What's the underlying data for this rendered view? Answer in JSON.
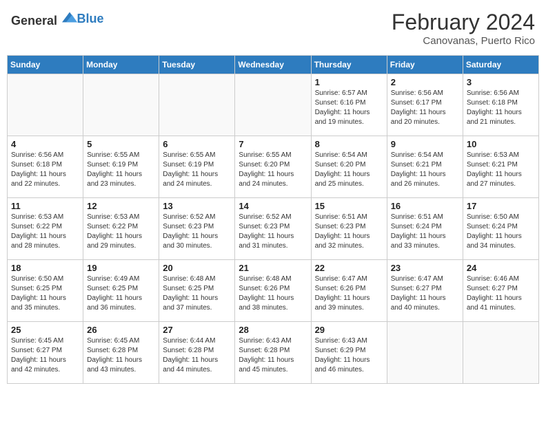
{
  "header": {
    "logo_general": "General",
    "logo_blue": "Blue",
    "title": "February 2024",
    "subtitle": "Canovanas, Puerto Rico"
  },
  "days_of_week": [
    "Sunday",
    "Monday",
    "Tuesday",
    "Wednesday",
    "Thursday",
    "Friday",
    "Saturday"
  ],
  "weeks": [
    [
      {
        "day": "",
        "detail": ""
      },
      {
        "day": "",
        "detail": ""
      },
      {
        "day": "",
        "detail": ""
      },
      {
        "day": "",
        "detail": ""
      },
      {
        "day": "1",
        "detail": "Sunrise: 6:57 AM\nSunset: 6:16 PM\nDaylight: 11 hours\nand 19 minutes."
      },
      {
        "day": "2",
        "detail": "Sunrise: 6:56 AM\nSunset: 6:17 PM\nDaylight: 11 hours\nand 20 minutes."
      },
      {
        "day": "3",
        "detail": "Sunrise: 6:56 AM\nSunset: 6:18 PM\nDaylight: 11 hours\nand 21 minutes."
      }
    ],
    [
      {
        "day": "4",
        "detail": "Sunrise: 6:56 AM\nSunset: 6:18 PM\nDaylight: 11 hours\nand 22 minutes."
      },
      {
        "day": "5",
        "detail": "Sunrise: 6:55 AM\nSunset: 6:19 PM\nDaylight: 11 hours\nand 23 minutes."
      },
      {
        "day": "6",
        "detail": "Sunrise: 6:55 AM\nSunset: 6:19 PM\nDaylight: 11 hours\nand 24 minutes."
      },
      {
        "day": "7",
        "detail": "Sunrise: 6:55 AM\nSunset: 6:20 PM\nDaylight: 11 hours\nand 24 minutes."
      },
      {
        "day": "8",
        "detail": "Sunrise: 6:54 AM\nSunset: 6:20 PM\nDaylight: 11 hours\nand 25 minutes."
      },
      {
        "day": "9",
        "detail": "Sunrise: 6:54 AM\nSunset: 6:21 PM\nDaylight: 11 hours\nand 26 minutes."
      },
      {
        "day": "10",
        "detail": "Sunrise: 6:53 AM\nSunset: 6:21 PM\nDaylight: 11 hours\nand 27 minutes."
      }
    ],
    [
      {
        "day": "11",
        "detail": "Sunrise: 6:53 AM\nSunset: 6:22 PM\nDaylight: 11 hours\nand 28 minutes."
      },
      {
        "day": "12",
        "detail": "Sunrise: 6:53 AM\nSunset: 6:22 PM\nDaylight: 11 hours\nand 29 minutes."
      },
      {
        "day": "13",
        "detail": "Sunrise: 6:52 AM\nSunset: 6:23 PM\nDaylight: 11 hours\nand 30 minutes."
      },
      {
        "day": "14",
        "detail": "Sunrise: 6:52 AM\nSunset: 6:23 PM\nDaylight: 11 hours\nand 31 minutes."
      },
      {
        "day": "15",
        "detail": "Sunrise: 6:51 AM\nSunset: 6:23 PM\nDaylight: 11 hours\nand 32 minutes."
      },
      {
        "day": "16",
        "detail": "Sunrise: 6:51 AM\nSunset: 6:24 PM\nDaylight: 11 hours\nand 33 minutes."
      },
      {
        "day": "17",
        "detail": "Sunrise: 6:50 AM\nSunset: 6:24 PM\nDaylight: 11 hours\nand 34 minutes."
      }
    ],
    [
      {
        "day": "18",
        "detail": "Sunrise: 6:50 AM\nSunset: 6:25 PM\nDaylight: 11 hours\nand 35 minutes."
      },
      {
        "day": "19",
        "detail": "Sunrise: 6:49 AM\nSunset: 6:25 PM\nDaylight: 11 hours\nand 36 minutes."
      },
      {
        "day": "20",
        "detail": "Sunrise: 6:48 AM\nSunset: 6:25 PM\nDaylight: 11 hours\nand 37 minutes."
      },
      {
        "day": "21",
        "detail": "Sunrise: 6:48 AM\nSunset: 6:26 PM\nDaylight: 11 hours\nand 38 minutes."
      },
      {
        "day": "22",
        "detail": "Sunrise: 6:47 AM\nSunset: 6:26 PM\nDaylight: 11 hours\nand 39 minutes."
      },
      {
        "day": "23",
        "detail": "Sunrise: 6:47 AM\nSunset: 6:27 PM\nDaylight: 11 hours\nand 40 minutes."
      },
      {
        "day": "24",
        "detail": "Sunrise: 6:46 AM\nSunset: 6:27 PM\nDaylight: 11 hours\nand 41 minutes."
      }
    ],
    [
      {
        "day": "25",
        "detail": "Sunrise: 6:45 AM\nSunset: 6:27 PM\nDaylight: 11 hours\nand 42 minutes."
      },
      {
        "day": "26",
        "detail": "Sunrise: 6:45 AM\nSunset: 6:28 PM\nDaylight: 11 hours\nand 43 minutes."
      },
      {
        "day": "27",
        "detail": "Sunrise: 6:44 AM\nSunset: 6:28 PM\nDaylight: 11 hours\nand 44 minutes."
      },
      {
        "day": "28",
        "detail": "Sunrise: 6:43 AM\nSunset: 6:28 PM\nDaylight: 11 hours\nand 45 minutes."
      },
      {
        "day": "29",
        "detail": "Sunrise: 6:43 AM\nSunset: 6:29 PM\nDaylight: 11 hours\nand 46 minutes."
      },
      {
        "day": "",
        "detail": ""
      },
      {
        "day": "",
        "detail": ""
      }
    ]
  ]
}
